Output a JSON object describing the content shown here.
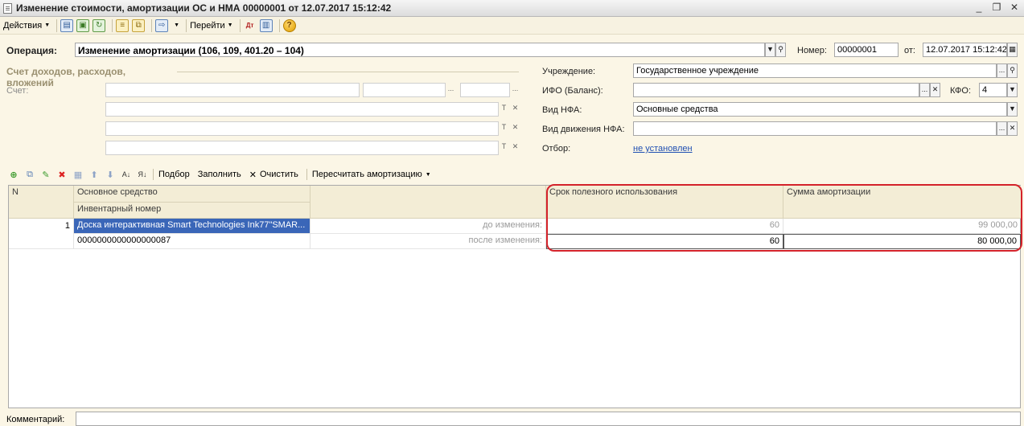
{
  "window": {
    "title": "Изменение стоимости, амортизации ОС и НМА 00000001 от 12.07.2017 15:12:42",
    "minimize": "_",
    "restore": "❐",
    "close": "✕"
  },
  "toolbar": {
    "actions_label": "Действия",
    "goto_label": "Перейти",
    "help_label": "?"
  },
  "header": {
    "operation_label": "Операция:",
    "operation_value": "Изменение амортизации (106, 109, 401.20 – 104)",
    "number_label": "Номер:",
    "number_value": "00000001",
    "date_label": "от:",
    "date_value": "12.07.2017 15:12:42"
  },
  "left_section": {
    "title": "Счет доходов, расходов, вложений",
    "account_label": "Счет:"
  },
  "right_section": {
    "institution_label": "Учреждение:",
    "institution_value": "Государственное учреждение",
    "ifo_label": "ИФО (Баланс):",
    "ifo_value": "",
    "kfo_label": "КФО:",
    "kfo_value": "4",
    "nfa_type_label": "Вид НФА:",
    "nfa_type_value": "Основные средства",
    "nfa_movement_label": "Вид движения НФА:",
    "nfa_movement_value": "",
    "filter_label": "Отбор:",
    "filter_value": "не установлен"
  },
  "grid_toolbar": {
    "select_label": "Подбор",
    "fill_label": "Заполнить",
    "clear_label": "Очистить",
    "recalc_label": "Пересчитать амортизацию"
  },
  "grid": {
    "col_n": "N",
    "col_asset": "Основное средство",
    "col_inventory": "Инвентарный номер",
    "col_useful_life": "Срок полезного использования",
    "col_amortization": "Сумма амортизации",
    "rows": [
      {
        "n": "1",
        "asset": "Доска интерактивная Smart Technologies Ink77\"SMAR...",
        "inventory": "0000000000000000087",
        "before_label": "до изменения:",
        "after_label": "после изменения:",
        "life_before": "60",
        "life_after": "60",
        "amort_before": "99 000,00",
        "amort_after": "80 000,00"
      }
    ]
  },
  "footer": {
    "comment_label": "Комментарий:"
  },
  "colors": {
    "background": "#fbf6e6",
    "selection": "#3a66b8",
    "highlight": "#d4222a",
    "link": "#1f4fb2"
  }
}
